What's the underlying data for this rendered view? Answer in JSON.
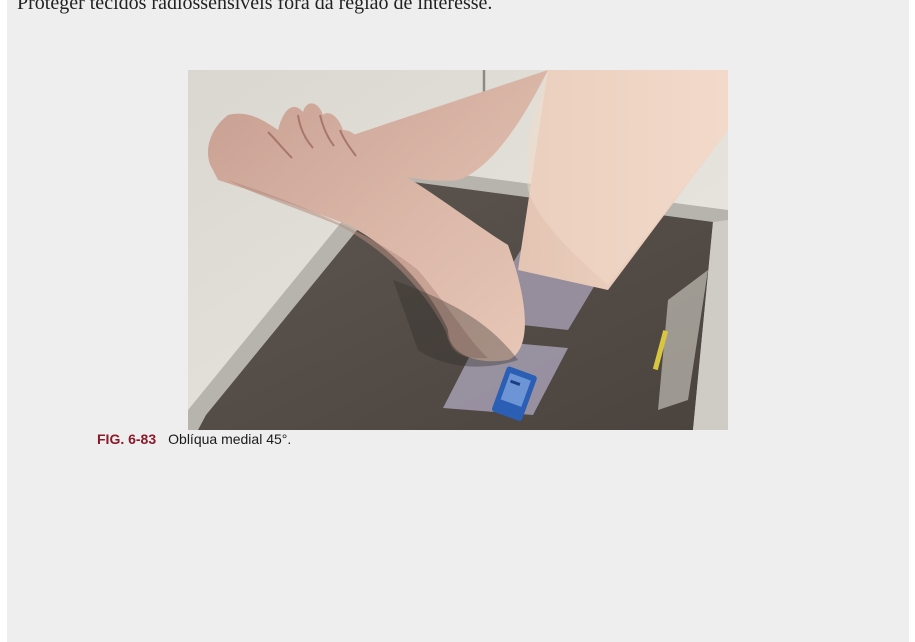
{
  "body_text": "Proteger tecidos radiossensíveis fora da região de interesse.",
  "figure": {
    "label": "FIG. 6-83",
    "caption": "Oblíqua medial 45°."
  }
}
